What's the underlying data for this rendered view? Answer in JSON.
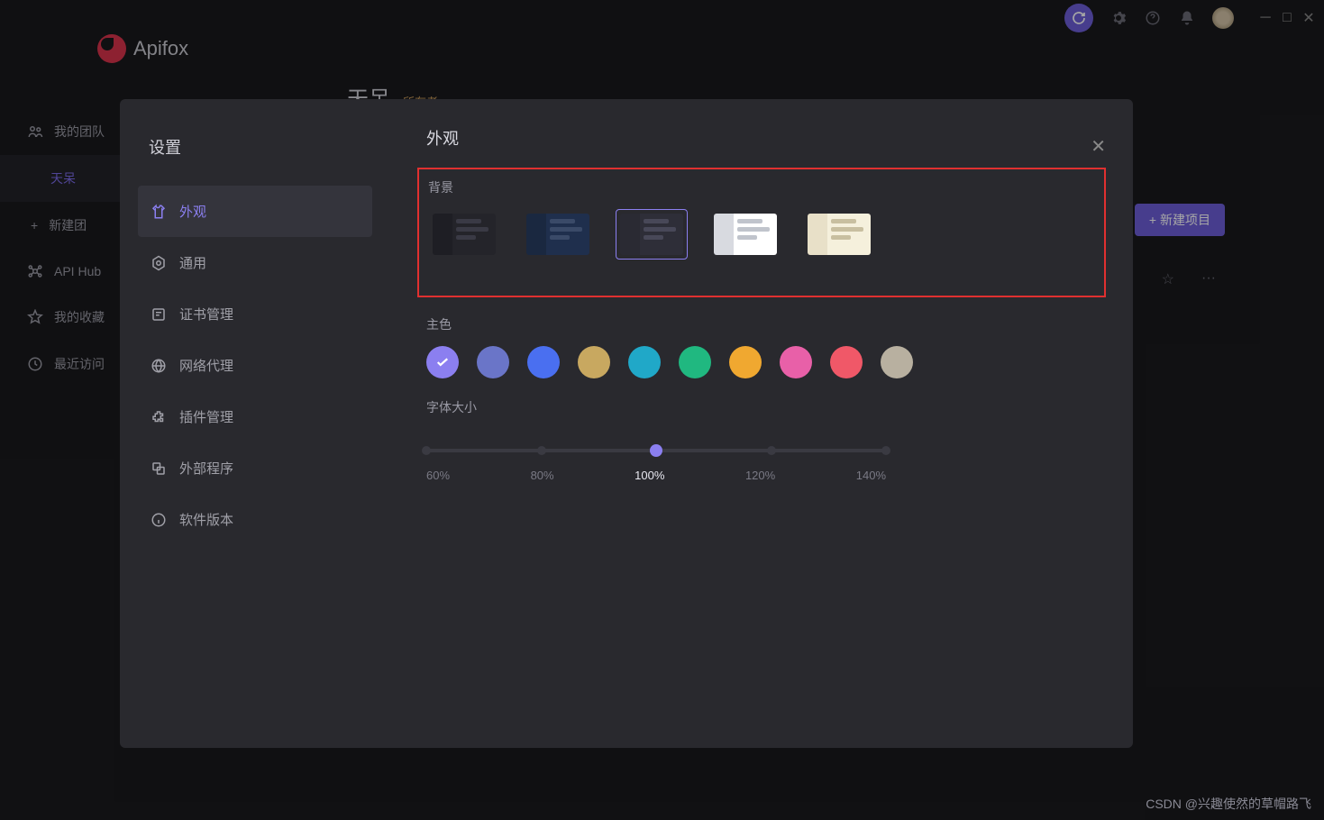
{
  "app": {
    "name": "Apifox"
  },
  "sidebar": {
    "items": [
      {
        "label": "我的团队",
        "icon": "team"
      },
      {
        "label": "天呆",
        "icon": ""
      },
      {
        "label": "新建团",
        "icon": "plus"
      },
      {
        "label": "API Hub",
        "icon": "hub"
      },
      {
        "label": "我的收藏",
        "icon": "star"
      },
      {
        "label": "最近访问",
        "icon": "clock"
      }
    ]
  },
  "background": {
    "title": "天呆",
    "owner_badge": "所有者",
    "new_project": "新建项目"
  },
  "modal": {
    "title": "设置",
    "nav": [
      {
        "label": "外观",
        "icon": "shirt"
      },
      {
        "label": "通用",
        "icon": "gear-hex"
      },
      {
        "label": "证书管理",
        "icon": "cert"
      },
      {
        "label": "网络代理",
        "icon": "globe"
      },
      {
        "label": "插件管理",
        "icon": "plugin"
      },
      {
        "label": "外部程序",
        "icon": "external"
      },
      {
        "label": "软件版本",
        "icon": "info"
      }
    ],
    "panel": {
      "title": "外观",
      "background_label": "背景",
      "themes": [
        {
          "side": "#1e1e24",
          "main": "#24242a",
          "line": "#3a3a45",
          "selected": false
        },
        {
          "side": "#1a2840",
          "main": "#1f2f4d",
          "line": "#3a4a68",
          "selected": false
        },
        {
          "side": "#2a2a33",
          "main": "#2e2e38",
          "line": "#484858",
          "selected": true
        },
        {
          "side": "#d8dae0",
          "main": "#ffffff",
          "line": "#c0c4cc",
          "selected": false
        },
        {
          "side": "#e8e0c8",
          "main": "#f5f0dc",
          "line": "#c8bfa0",
          "selected": false
        }
      ],
      "primary_label": "主色",
      "colors": [
        "#8b7ff0",
        "#6a75c8",
        "#4a6ff0",
        "#c8a860",
        "#20a8c8",
        "#20b880",
        "#f0a830",
        "#e860a8",
        "#f05868",
        "#b8b0a0"
      ],
      "selected_color_index": 0,
      "font_label": "字体大小",
      "font_sizes": [
        "60%",
        "80%",
        "100%",
        "120%",
        "140%"
      ],
      "font_selected_index": 2
    }
  },
  "watermark": "CSDN @兴趣使然的草帽路飞"
}
